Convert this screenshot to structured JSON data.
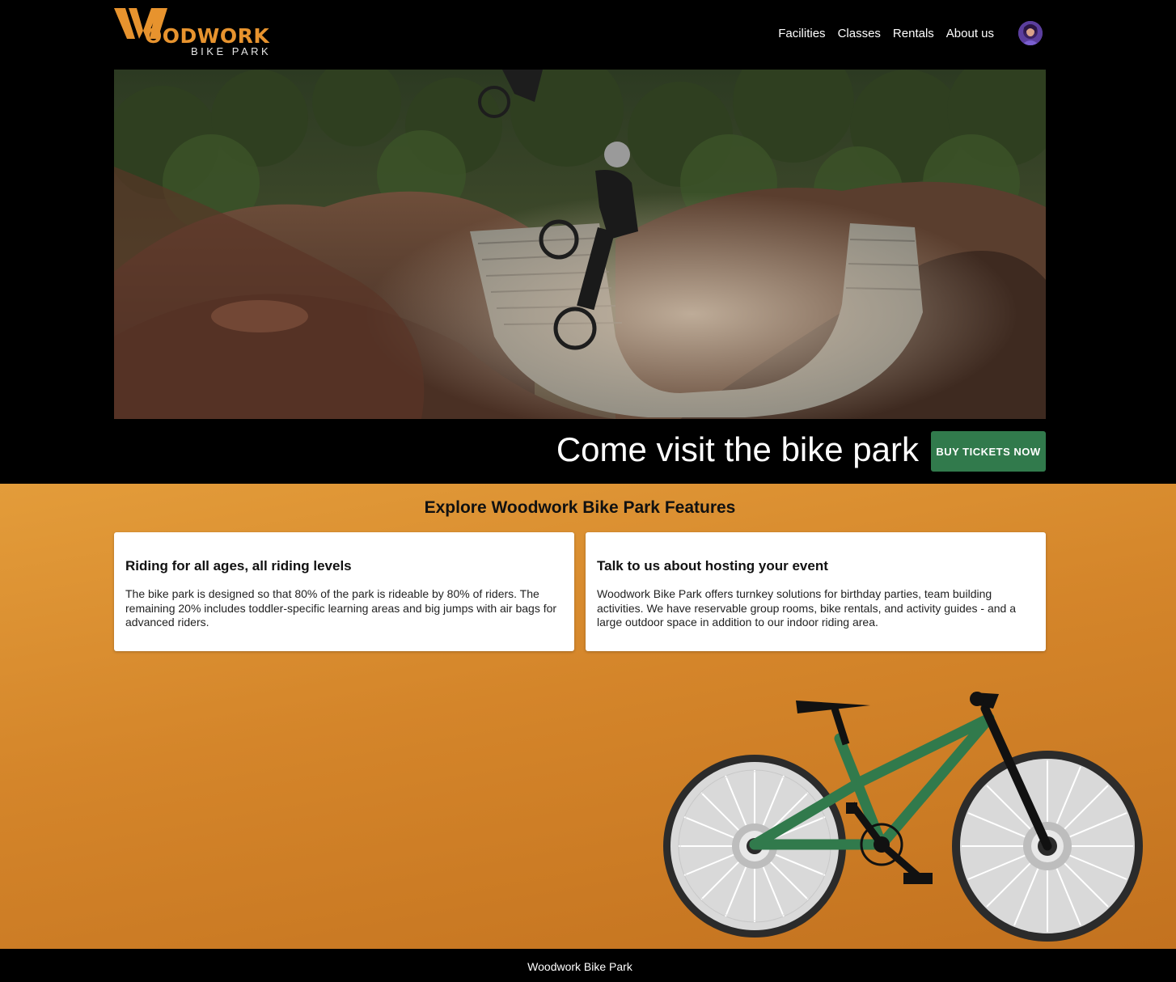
{
  "header": {
    "logo_main": "OODWORK",
    "logo_sub": "BIKE PARK",
    "logo_color": "#e7932e",
    "nav": [
      "Facilities",
      "Classes",
      "Rentals",
      "About us"
    ]
  },
  "hero": {
    "title": "Come visit the bike park",
    "cta_label": "BUY TICKETS NOW",
    "cta_color": "#317a4c"
  },
  "features": {
    "title": "Explore Woodwork Bike Park Features",
    "cards": [
      {
        "title": "Riding for all ages, all riding levels",
        "body": "The bike park is designed so that 80% of the park is rideable by 80% of riders. The remaining 20% includes toddler-specific learning areas and big jumps with air bags for advanced riders."
      },
      {
        "title": "Talk to us about hosting your event",
        "body": "Woodwork Bike Park offers turnkey solutions for birthday parties, team building activities. We have reservable group rooms, bike rentals, and activity guides - and a large outdoor space in addition to our indoor riding area."
      }
    ]
  },
  "footer": {
    "text": "Woodwork Bike Park"
  },
  "icons": {
    "logo": "woodwork-w-logo",
    "avatar": "user-avatar",
    "illustration": "bicycle-illustration"
  }
}
